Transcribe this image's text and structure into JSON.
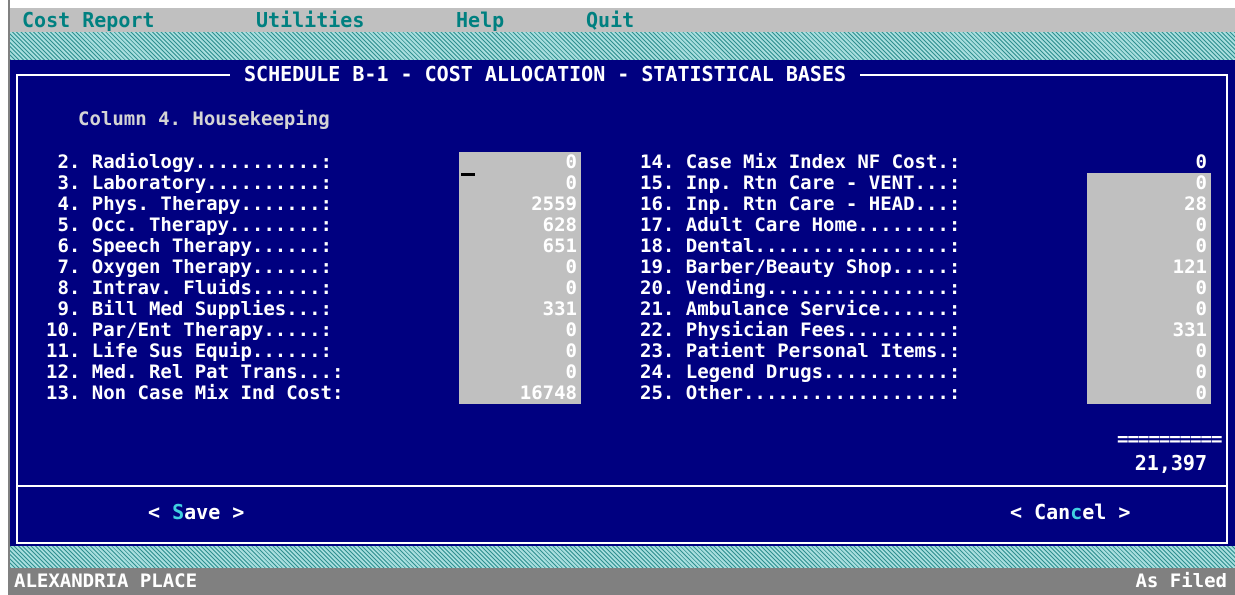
{
  "menu": {
    "items": [
      "Cost Report",
      "Utilities",
      "Help",
      "Quit"
    ]
  },
  "dialog": {
    "title": "SCHEDULE B-1 - COST ALLOCATION - STATISTICAL BASES",
    "column_header": "Column 4. Housekeeping"
  },
  "left_rows": [
    {
      "label": " 2. Radiology...........:",
      "value": "0"
    },
    {
      "label": " 3. Laboratory..........:",
      "value": "0"
    },
    {
      "label": " 4. Phys. Therapy.......:",
      "value": "2559"
    },
    {
      "label": " 5. Occ. Therapy........:",
      "value": "628"
    },
    {
      "label": " 6. Speech Therapy......:",
      "value": "651"
    },
    {
      "label": " 7. Oxygen Therapy......:",
      "value": "0"
    },
    {
      "label": " 8. Intrav. Fluids......:",
      "value": "0"
    },
    {
      "label": " 9. Bill Med Supplies...:",
      "value": "331"
    },
    {
      "label": "10. Par/Ent Therapy.....:",
      "value": "0"
    },
    {
      "label": "11. Life Sus Equip......:",
      "value": "0"
    },
    {
      "label": "12. Med. Rel Pat Trans...:",
      "value": "0"
    },
    {
      "label": "13. Non Case Mix Ind Cost:",
      "value": "16748"
    }
  ],
  "right_rows": [
    {
      "label": "14. Case Mix Index NF Cost.:",
      "value": "0"
    },
    {
      "label": "15. Inp. Rtn Care - VENT...:",
      "value": "0"
    },
    {
      "label": "16. Inp. Rtn Care - HEAD...:",
      "value": "28"
    },
    {
      "label": "17. Adult Care Home........:",
      "value": "0"
    },
    {
      "label": "18. Dental.................:",
      "value": "0"
    },
    {
      "label": "19. Barber/Beauty Shop.....:",
      "value": "121"
    },
    {
      "label": "20. Vending................:",
      "value": "0"
    },
    {
      "label": "21. Ambulance Service......:",
      "value": "0"
    },
    {
      "label": "22. Physician Fees.........:",
      "value": "331"
    },
    {
      "label": "23. Patient Personal Items.:",
      "value": "0"
    },
    {
      "label": "24. Legend Drugs...........:",
      "value": "0"
    },
    {
      "label": "25. Other..................:",
      "value": "0"
    }
  ],
  "totals": {
    "separator": "==========",
    "total": "21,397"
  },
  "buttons": {
    "save": {
      "open": "< ",
      "hot": "S",
      "rest": "ave",
      "close": " >"
    },
    "cancel": {
      "open": "< ",
      "pre": "Can",
      "hot": "c",
      "rest": "el",
      "close": " >"
    }
  },
  "status": {
    "facility": "ALEXANDRIA PLACE",
    "mode": "As Filed"
  },
  "colors": {
    "dialog_bg": "#000080",
    "field_bg": "#c0c0c0",
    "hotkey": "#40d0e0",
    "menu_text": "#008080",
    "hatch": "#58b0b0"
  }
}
